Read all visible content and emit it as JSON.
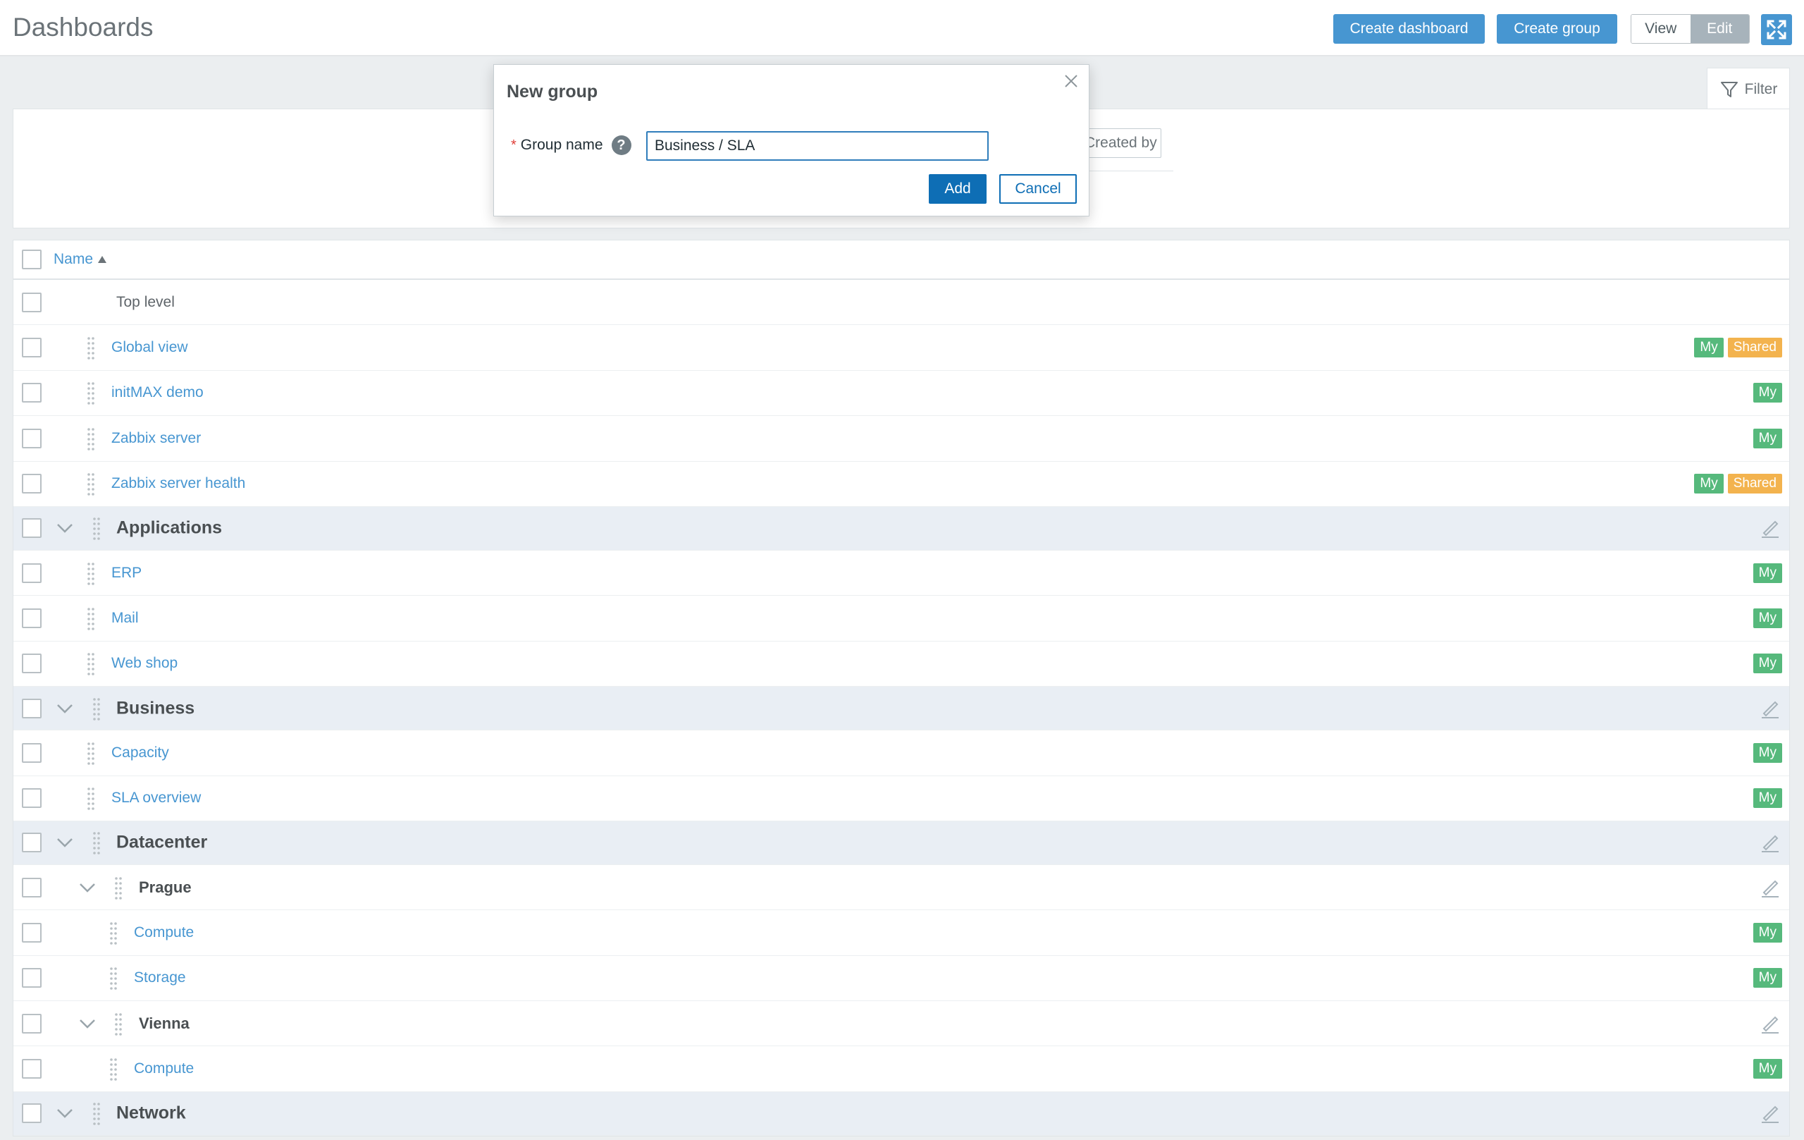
{
  "header": {
    "title": "Dashboards",
    "create_dashboard": "Create dashboard",
    "create_group": "Create group",
    "view": "View",
    "edit": "Edit",
    "fullscreen_icon": "fullscreen-icon"
  },
  "filter": {
    "tab_label": "Filter",
    "chip_text": "Created by me"
  },
  "list": {
    "column_name": "Name",
    "sort": "ascending",
    "rows": [
      {
        "type": "plain",
        "label": "Top level"
      },
      {
        "type": "item",
        "label": "Global view",
        "badges": [
          "My",
          "Shared"
        ]
      },
      {
        "type": "item",
        "label": "initMAX demo",
        "badges": [
          "My"
        ]
      },
      {
        "type": "item",
        "label": "Zabbix server",
        "badges": [
          "My"
        ]
      },
      {
        "type": "item",
        "label": "Zabbix server health",
        "badges": [
          "My",
          "Shared"
        ]
      },
      {
        "type": "group",
        "label": "Applications"
      },
      {
        "type": "item",
        "label": "ERP",
        "badges": [
          "My"
        ]
      },
      {
        "type": "item",
        "label": "Mail",
        "badges": [
          "My"
        ]
      },
      {
        "type": "item",
        "label": "Web shop",
        "badges": [
          "My"
        ]
      },
      {
        "type": "group",
        "label": "Business"
      },
      {
        "type": "item",
        "label": "Capacity",
        "badges": [
          "My"
        ]
      },
      {
        "type": "item",
        "label": "SLA overview",
        "badges": [
          "My"
        ]
      },
      {
        "type": "group",
        "label": "Datacenter"
      },
      {
        "type": "subgroup",
        "label": "Prague"
      },
      {
        "type": "subitem",
        "label": "Compute",
        "badges": [
          "My"
        ]
      },
      {
        "type": "subitem",
        "label": "Storage",
        "badges": [
          "My"
        ]
      },
      {
        "type": "subgroup",
        "label": "Vienna"
      },
      {
        "type": "subitem",
        "label": "Compute",
        "badges": [
          "My"
        ]
      },
      {
        "type": "group",
        "label": "Network"
      }
    ]
  },
  "modal": {
    "title": "New group",
    "required_mark": "*",
    "field_label": "Group name",
    "help": "?",
    "field_value": "Business / SLA",
    "add": "Add",
    "cancel": "Cancel"
  },
  "colors": {
    "accent": "#4796d1",
    "primary_dark": "#0e6eb5",
    "badge_my": "#56b97c",
    "badge_shared": "#f3b34e",
    "group_row_bg": "#e9eef4"
  }
}
